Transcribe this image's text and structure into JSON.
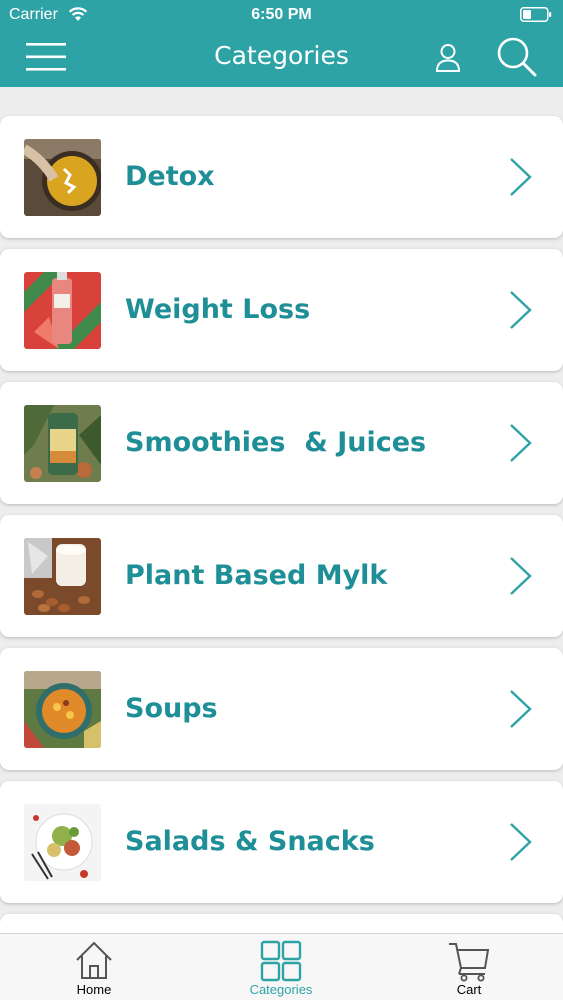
{
  "status_bar": {
    "carrier": "Carrier",
    "time": "6:50 PM"
  },
  "header": {
    "title": "Categories",
    "icons": [
      "menu-icon",
      "user-icon",
      "search-icon"
    ]
  },
  "categories": [
    {
      "label": "Detox",
      "image": "detox-thumbnail"
    },
    {
      "label": "Weight Loss",
      "image": "weight-loss-thumbnail"
    },
    {
      "label": "Smoothies  & Juices",
      "image": "smoothies-thumbnail"
    },
    {
      "label": "Plant Based Mylk",
      "image": "plant-mylk-thumbnail"
    },
    {
      "label": "Soups",
      "image": "soups-thumbnail"
    },
    {
      "label": "Salads & Snacks",
      "image": "salads-thumbnail"
    }
  ],
  "tabbar": {
    "tabs": [
      {
        "label": "Home",
        "icon": "home-icon",
        "active": false
      },
      {
        "label": "Categories",
        "icon": "grid-icon",
        "active": true
      },
      {
        "label": "Cart",
        "icon": "cart-icon",
        "active": false
      }
    ]
  },
  "colors": {
    "accent": "#2ea3a6",
    "label_text": "#1e8e97",
    "background": "#ededed",
    "tab_active": "#2ea3a6",
    "tab_inactive": "#000000"
  }
}
